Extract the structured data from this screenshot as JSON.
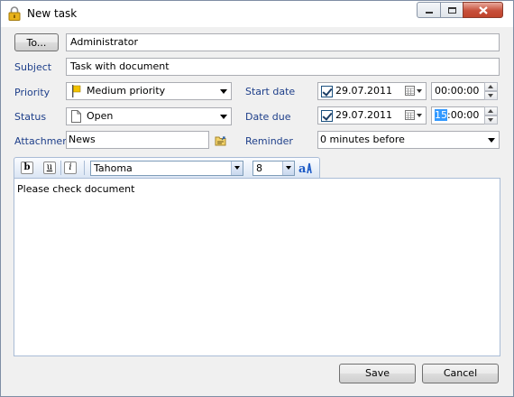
{
  "window": {
    "title": "New task",
    "minimize_icon": "minimize-icon",
    "maximize_icon": "maximize-icon",
    "close_icon": "close-icon"
  },
  "to": {
    "button_label": "To...",
    "value": "Administrator"
  },
  "subject": {
    "label": "Subject",
    "value": "Task with document"
  },
  "priority": {
    "label": "Priority",
    "value": "Medium priority",
    "icon": "flag-icon",
    "flag_color": "#f2c200"
  },
  "status": {
    "label": "Status",
    "value": "Open",
    "icon": "document-icon"
  },
  "attachment": {
    "label": "Attachment",
    "value": "News",
    "icon": "attach-file-icon"
  },
  "start_date": {
    "label": "Start date",
    "checked": true,
    "date": "29.07.2011",
    "time": "00:00:00"
  },
  "date_due": {
    "label": "Date due",
    "checked": true,
    "date": "29.07.2011",
    "time_selected": "15",
    "time_rest": ":00:00"
  },
  "reminder": {
    "label": "Reminder",
    "value": "0 minutes before"
  },
  "editor": {
    "bold_label": "b",
    "underline_label": "u",
    "italic_label": "i",
    "font_name": "Tahoma",
    "font_size": "8",
    "font_color_icon": "font-color-icon",
    "body": "Please check document"
  },
  "actions": {
    "save_label": "Save",
    "cancel_label": "Cancel"
  }
}
